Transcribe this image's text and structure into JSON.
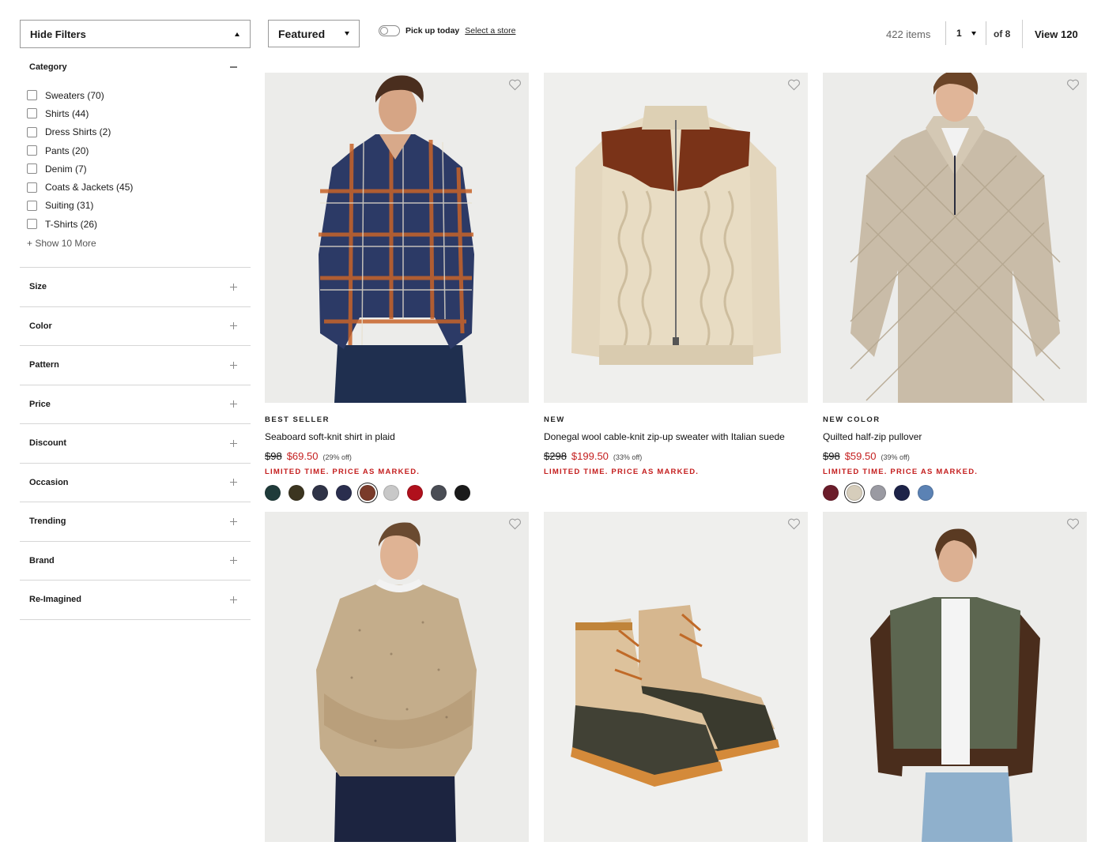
{
  "filters": {
    "hide_label": "Hide Filters",
    "category_title": "Category",
    "categories": [
      {
        "label": "Sweaters (70)"
      },
      {
        "label": "Shirts (44)"
      },
      {
        "label": "Dress Shirts (2)"
      },
      {
        "label": "Pants (20)"
      },
      {
        "label": "Denim (7)"
      },
      {
        "label": "Coats & Jackets (45)"
      },
      {
        "label": "Suiting (31)"
      },
      {
        "label": "T-Shirts (26)"
      }
    ],
    "show_more": "+ Show 10 More",
    "groups": [
      {
        "label": "Size"
      },
      {
        "label": "Color"
      },
      {
        "label": "Pattern"
      },
      {
        "label": "Price"
      },
      {
        "label": "Discount"
      },
      {
        "label": "Occasion"
      },
      {
        "label": "Trending"
      },
      {
        "label": "Brand"
      },
      {
        "label": "Re-Imagined"
      }
    ]
  },
  "toolbar": {
    "sort_value": "Featured",
    "pickup_label": "Pick up today",
    "pickup_link": "Select a store",
    "items_count": "422 items",
    "page_value": "1",
    "page_of": "of 8",
    "view_label": "View 120"
  },
  "products": [
    {
      "badge": "BEST SELLER",
      "name": "Seaboard soft-knit shirt in plaid",
      "old_price": "$98",
      "new_price": "$69.50",
      "off": "(29% off)",
      "limited": "LIMITED TIME. PRICE AS MARKED.",
      "swatches": [
        "#1f3b3a",
        "#3c3520",
        "#2f3347",
        "#2a2e4e",
        "#7a3b2a",
        "#c8c8c8",
        "#b0101c",
        "#4a4d55",
        "#1a1a1a"
      ],
      "selected_swatch": 4
    },
    {
      "badge": "NEW",
      "name": "Donegal wool cable-knit zip-up sweater with Italian suede",
      "old_price": "$298",
      "new_price": "$199.50",
      "off": "(33% off)",
      "limited": "LIMITED TIME. PRICE AS MARKED."
    },
    {
      "badge": "NEW COLOR",
      "name": "Quilted half-zip pullover",
      "old_price": "$98",
      "new_price": "$59.50",
      "off": "(39% off)",
      "limited": "LIMITED TIME. PRICE AS MARKED.",
      "swatches": [
        "#6b1c2a",
        "#d6cdbb",
        "#9a9aa2",
        "#1d2348",
        "#5b82b4"
      ],
      "selected_swatch": 1
    }
  ],
  "colors": {
    "sale_red": "#c41e1e",
    "image_bg": "#ececec",
    "border": "#d6d6d6"
  }
}
